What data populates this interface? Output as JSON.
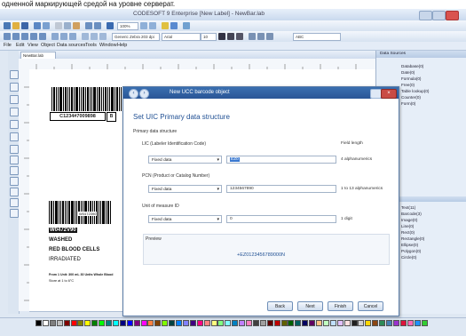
{
  "caption": "одненной маркирующей средой на уровне серверат.",
  "window": {
    "title": "CODESOFT 9 Enterprise [New Label] - NewBar.lab"
  },
  "menu": [
    "File",
    "Edit",
    "View",
    "Object",
    "Data sources",
    "Tools",
    "Window",
    "Help"
  ],
  "toolbar": {
    "font_combo": "Arial",
    "size_combo": "10",
    "zoom_combo": "100%",
    "printer_combo": "Generic Zebra 203 dpi",
    "field_combo": "ABC"
  },
  "document_tab": "NewBar.lab",
  "label": {
    "top_code": "C1234#7009898",
    "top_flag": "B",
    "bottom_overlay": "W0472390",
    "id_line": "W0472V90",
    "product_line1": "WASHED",
    "product_line2": "RED BLOOD CELLS",
    "product_line3": "IRRADIATED",
    "small_line1": "From 1 Unit: 300 mL 30 Units Whole Blood",
    "small_line2": "Store at 1 to 6°C"
  },
  "data_sources": {
    "title": "Data Sources",
    "items_top": [
      "Database(0)",
      "Date(0)",
      "Formula(0)",
      "Free(0)",
      "Table lookup(0)",
      "Counter(0)",
      "Form(0)"
    ],
    "items_bottom": [
      "Text(11)",
      "Barcode(3)",
      "Image(0)",
      "Line(0)",
      "Rect(0)",
      "Rectangle(0)",
      "Ellipse(0)",
      "Polygon(0)",
      "Circle(0)"
    ]
  },
  "dialog": {
    "title": "New UCC barcode object",
    "heading": "Set UIC Primary data structure",
    "section": "Primary data structure",
    "field_length_header": "Field length",
    "fields": [
      {
        "label": "LIC (Labeler Identification Code)",
        "type": "Fixed data",
        "value": "EZ0",
        "note": "4 alphanumerics"
      },
      {
        "label": "PCN (Product or Catalog Number)",
        "type": "Fixed data",
        "value": "1234567890",
        "note": "1 to 13 alphanumerics"
      },
      {
        "label": "Unit of measure ID",
        "type": "Fixed data",
        "value": "0",
        "note": "1 digit"
      }
    ],
    "preview_label": "Preview",
    "preview_value": "+EZ0123456789000N",
    "buttons": {
      "back": "Back",
      "next": "Next",
      "finish": "Finish",
      "cancel": "Cancel"
    }
  },
  "palette_colors": [
    "#000000",
    "#ffffff",
    "#7f7f7f",
    "#c0c0c0",
    "#800000",
    "#ff0000",
    "#808000",
    "#ffff00",
    "#008000",
    "#00ff00",
    "#008080",
    "#00ffff",
    "#000080",
    "#0000ff",
    "#800080",
    "#ff00ff",
    "#ff8040",
    "#804000",
    "#80ff00",
    "#004040",
    "#0080ff",
    "#8080ff",
    "#400080",
    "#ff0080",
    "#ff8080",
    "#ffff80",
    "#80ff80",
    "#80ffff",
    "#0080c0",
    "#c080ff",
    "#ff80c0",
    "#404040",
    "#a0a0a0",
    "#600000",
    "#c00000",
    "#606000",
    "#006000",
    "#006060",
    "#000060",
    "#600060",
    "#ffc080",
    "#c0ffc0",
    "#c0e0ff",
    "#e0c0ff",
    "#ffe0e0",
    "#202020",
    "#d0d0d0",
    "#ffd700",
    "#8b4513",
    "#2e8b57",
    "#4682b4",
    "#9932cc",
    "#dc143c",
    "#ff69b4",
    "#1e90ff",
    "#32cd32"
  ]
}
